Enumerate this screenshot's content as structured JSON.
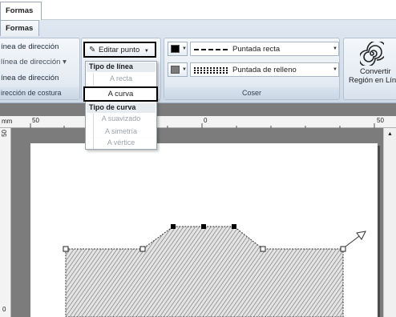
{
  "app": {
    "tab": "Formas"
  },
  "ribbon": {
    "tab": "Formas",
    "direction_group": {
      "items": [
        "ínea de dirección",
        "línea de dirección ▾",
        "ínea de dirección"
      ],
      "label": "irección de costura"
    },
    "edit_point_button": "Editar punto",
    "coser_group": {
      "label": "Coser",
      "running_stitch": "Puntada recta",
      "fill_stitch": "Puntada de relleno",
      "colors": {
        "running": "#000000",
        "fill": "#7b7b7b"
      }
    },
    "convert_group": {
      "line1": "Convertir",
      "line2": "Región en Lín"
    }
  },
  "menu": {
    "line_type_header": "Tipo de línea",
    "line_type_items": [
      {
        "label": "A recta",
        "enabled": false
      },
      {
        "label": "A curva",
        "enabled": true,
        "highlighted": true
      }
    ],
    "curve_type_header": "Tipo de curva",
    "curve_type_items": [
      {
        "label": "A suavizado",
        "enabled": false
      },
      {
        "label": "A simetría",
        "enabled": false
      },
      {
        "label": "A vértice",
        "enabled": false
      }
    ]
  },
  "ruler": {
    "corner": "mm",
    "h_ticks": [
      "50",
      "0",
      "50"
    ],
    "v_ticks": [
      "50",
      "0"
    ]
  }
}
